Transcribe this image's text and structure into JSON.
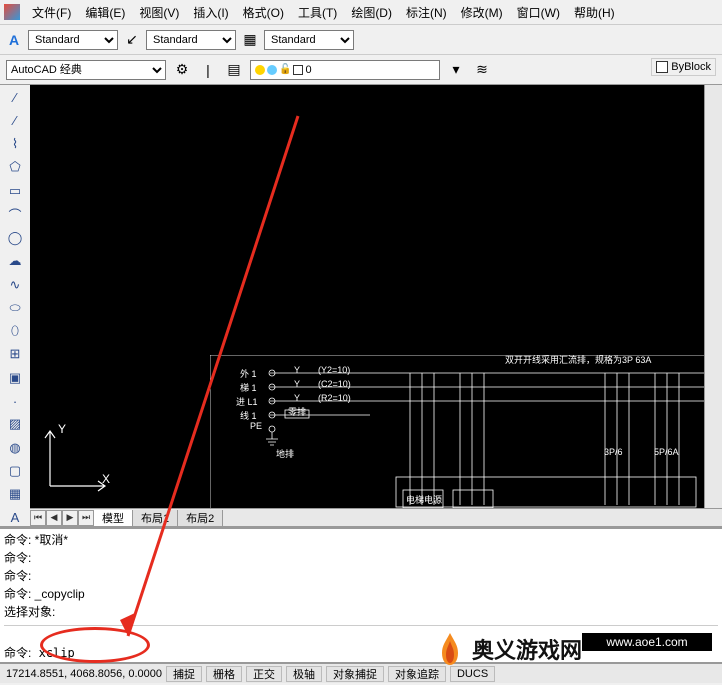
{
  "menus": {
    "file": "文件(F)",
    "edit": "编辑(E)",
    "view": "视图(V)",
    "insert": "插入(I)",
    "format": "格式(O)",
    "tools": "工具(T)",
    "draw": "绘图(D)",
    "dimension": "标注(N)",
    "modify": "修改(M)",
    "window": "窗口(W)",
    "help": "帮助(H)"
  },
  "toolbar": {
    "style1": "Standard",
    "style2": "Standard",
    "style3": "Standard"
  },
  "workspace": {
    "current": "AutoCAD 经典"
  },
  "layers": {
    "current": "0"
  },
  "byblock": "ByBlock",
  "ucs": {
    "x": "X",
    "y": "Y"
  },
  "tabs": {
    "model": "模型",
    "layout1": "布局1",
    "layout2": "布局2"
  },
  "drawing": {
    "title": "双开开线采用汇流排，规格为3P 63A",
    "r1": "外 1",
    "r2": "梯 1",
    "r3": "进 L1",
    "r4": "线 1",
    "v1": "Y",
    "v2": "Y",
    "v3": "Y",
    "c1": "(Y2=10)",
    "c2": "(C2=10)",
    "c3": "(R2=10)",
    "pe": "PE",
    "gnd": "零排",
    "dx": "地排",
    "box1": "电梯电源",
    "label2": "3P/6",
    "label3": "5P/6A"
  },
  "cmd": {
    "l1": "命令:  *取消*",
    "l2": "命令:",
    "l3": "命令:",
    "l4": "命令:  _copyclip",
    "l5": "选择对象:",
    "prompt": "命令:",
    "input": "xclip"
  },
  "status": {
    "coords": "17214.8551, 4068.8056, 0.0000",
    "b1": "捕捉",
    "b2": "栅格",
    "b3": "正交",
    "b4": "极轴",
    "b5": "对象捕捉",
    "b6": "对象追踪",
    "b7": "DUCS"
  },
  "logo": {
    "text": "奥义游戏网",
    "url": "www.aoe1.com"
  }
}
